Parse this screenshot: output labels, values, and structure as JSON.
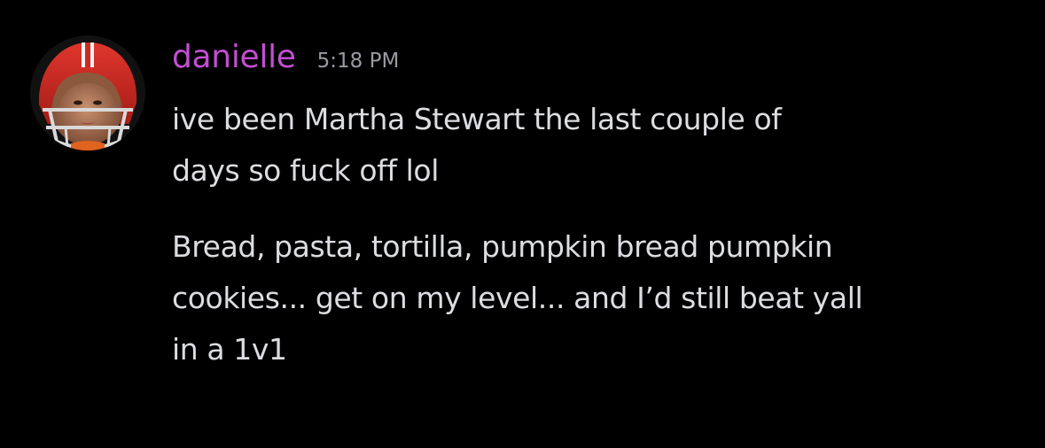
{
  "message": {
    "username": "danielle",
    "timestamp": "5:18 PM",
    "username_color": "#c24fd0",
    "text_color": "#dcdde1",
    "background": "#000000",
    "avatar_icon": "football-helmet-avatar",
    "lines": [
      [
        "ive been Martha Stewart the last couple of",
        "days so fuck off lol"
      ],
      [
        "Bread, pasta, tortilla, pumpkin bread pumpkin",
        "cookies... get on my level... and I’d still beat yall",
        "in a 1v1"
      ]
    ]
  }
}
